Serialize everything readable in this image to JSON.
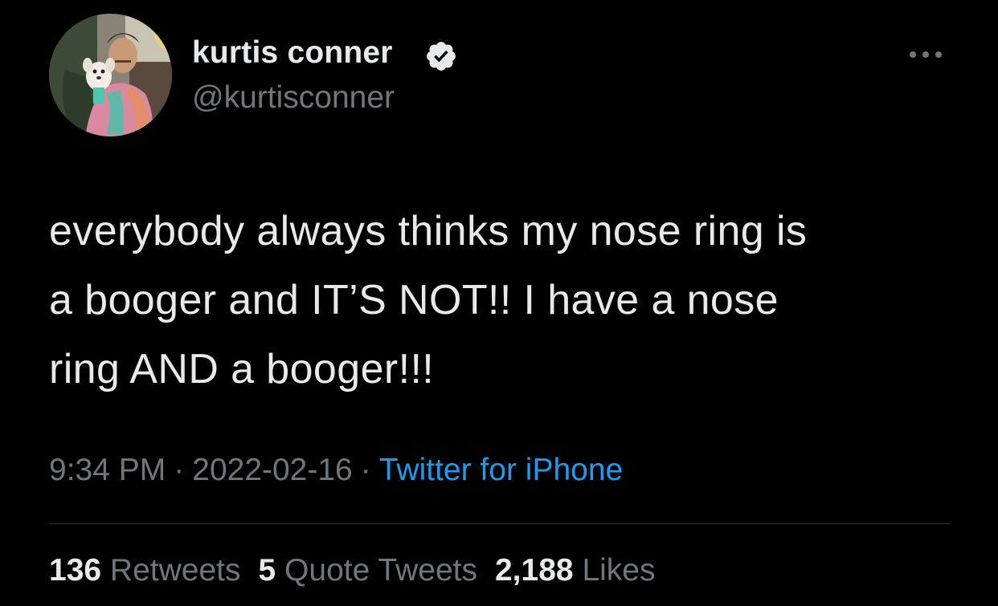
{
  "colors": {
    "background": "#000000",
    "primary_text": "#e7e9ea",
    "secondary_text": "#71767b",
    "link": "#1d9bf0",
    "divider": "#2f3336"
  },
  "author": {
    "display_name": "kurtis conner",
    "handle": "@kurtisconner",
    "verified_icon": "verified-badge-icon",
    "avatar_icon": "avatar"
  },
  "more_icon": "more-horizontal-icon",
  "tweet": {
    "text": "everybody always thinks my nose ring is\na booger and IT’S NOT!! I have a nose\nring AND a booger!!!"
  },
  "meta": {
    "time": "9:34 PM",
    "separator": "·",
    "date": "2022-02-16",
    "source": "Twitter for iPhone"
  },
  "stats": {
    "retweets_count": "136",
    "retweets_label": "Retweets",
    "quotes_count": "5",
    "quotes_label": "Quote Tweets",
    "likes_count": "2,188",
    "likes_label": "Likes"
  }
}
